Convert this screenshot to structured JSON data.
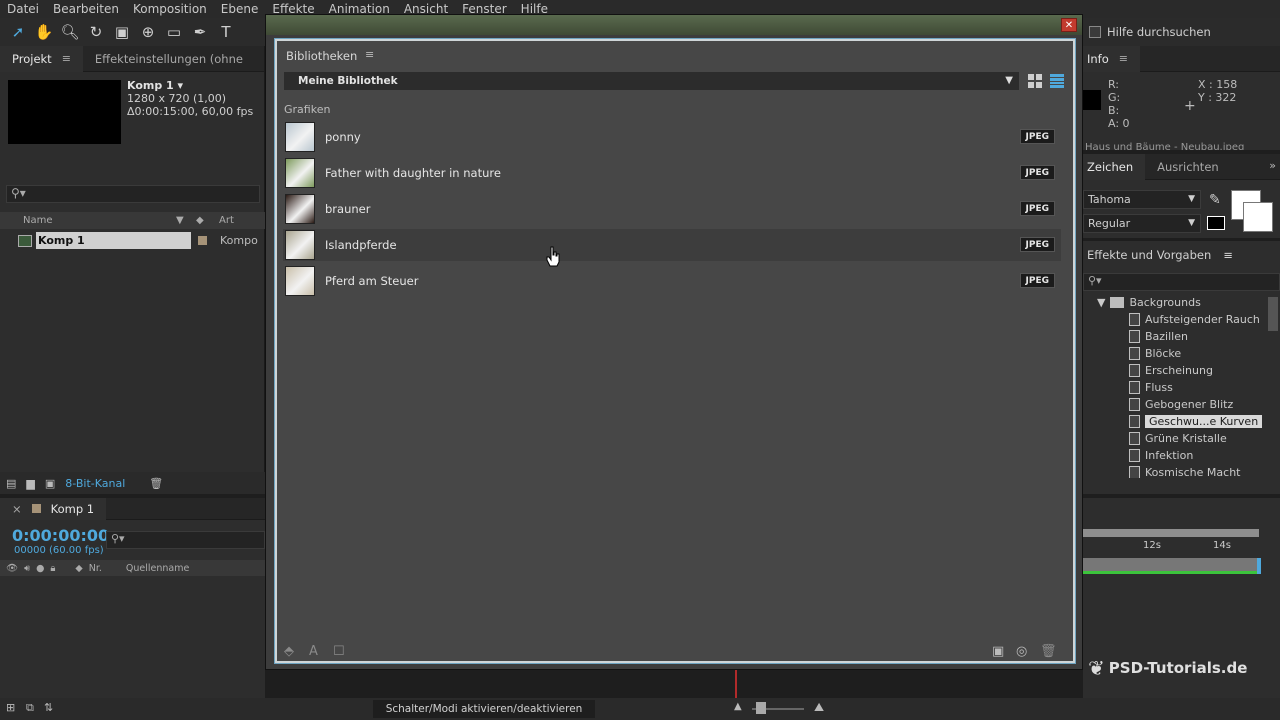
{
  "menu": [
    "Datei",
    "Bearbeiten",
    "Komposition",
    "Ebene",
    "Effekte",
    "Animation",
    "Ansicht",
    "Fenster",
    "Hilfe"
  ],
  "help_search": "Hilfe durchsuchen",
  "project": {
    "tabs": [
      "Projekt",
      "Effekteinstellungen (ohne"
    ],
    "comp_title": "Komp 1 ▾",
    "comp_size": "1280 x 720 (1,00)",
    "comp_duration": "Δ0:00:15:00, 60,00 fps",
    "search_glyph": "⚲▾",
    "col_name": "Name",
    "col_type": "Art",
    "row_name": "Komp 1",
    "row_type": "Kompo",
    "bit_depth": "8-Bit-Kanal"
  },
  "timeline": {
    "tab": "Komp 1",
    "timecode": "0:00:00:00",
    "fps": "00000 (60.00 fps)",
    "col_nr": "Nr.",
    "col_source": "Quellenname",
    "ticks": [
      "12s",
      "14s"
    ]
  },
  "status": {
    "toggle": "Schalter/Modi aktivieren/deaktivieren"
  },
  "info": {
    "title": "Info",
    "r": "R:",
    "g": "G:",
    "b": "B:",
    "a": "A:  0",
    "x": "X : 158",
    "y": "Y : 322",
    "status_line": "Haus und Bäume - Neubau.jpeg"
  },
  "character": {
    "tabs": [
      "Zeichen",
      "Ausrichten"
    ],
    "font": "Tahoma",
    "style": "Regular"
  },
  "effects": {
    "title": "Effekte und Vorgaben",
    "folder": "Backgrounds",
    "items": [
      "Aufsteigender Rauch",
      "Bazillen",
      "Blöcke",
      "Erscheinung",
      "Fluss",
      "Gebogener Blitz",
      "Geschwu...e Kurven",
      "Grüne Kristalle",
      "Infektion",
      "Kosmische Macht"
    ],
    "selected_index": 6
  },
  "library": {
    "title": "Bibliotheken",
    "selected_library": "Meine Bibliothek",
    "section": "Grafiken",
    "assets": [
      {
        "name": "ponny",
        "type": "JPEG",
        "thumb": "#b9c6cf"
      },
      {
        "name": "Father with daughter in nature",
        "type": "JPEG",
        "thumb": "#7d9a5c"
      },
      {
        "name": "brauner",
        "type": "JPEG",
        "thumb": "#2a1a14"
      },
      {
        "name": "Islandpferde",
        "type": "JPEG",
        "thumb": "#a9a48f"
      },
      {
        "name": "Pferd am Steuer",
        "type": "JPEG",
        "thumb": "#c9bfa9"
      }
    ],
    "hover_index": 3
  },
  "watermark": "PSD-Tutorials.de",
  "colors": {
    "accent": "#4fa9dd",
    "panel": "#474747",
    "close": "#c23b2e"
  }
}
